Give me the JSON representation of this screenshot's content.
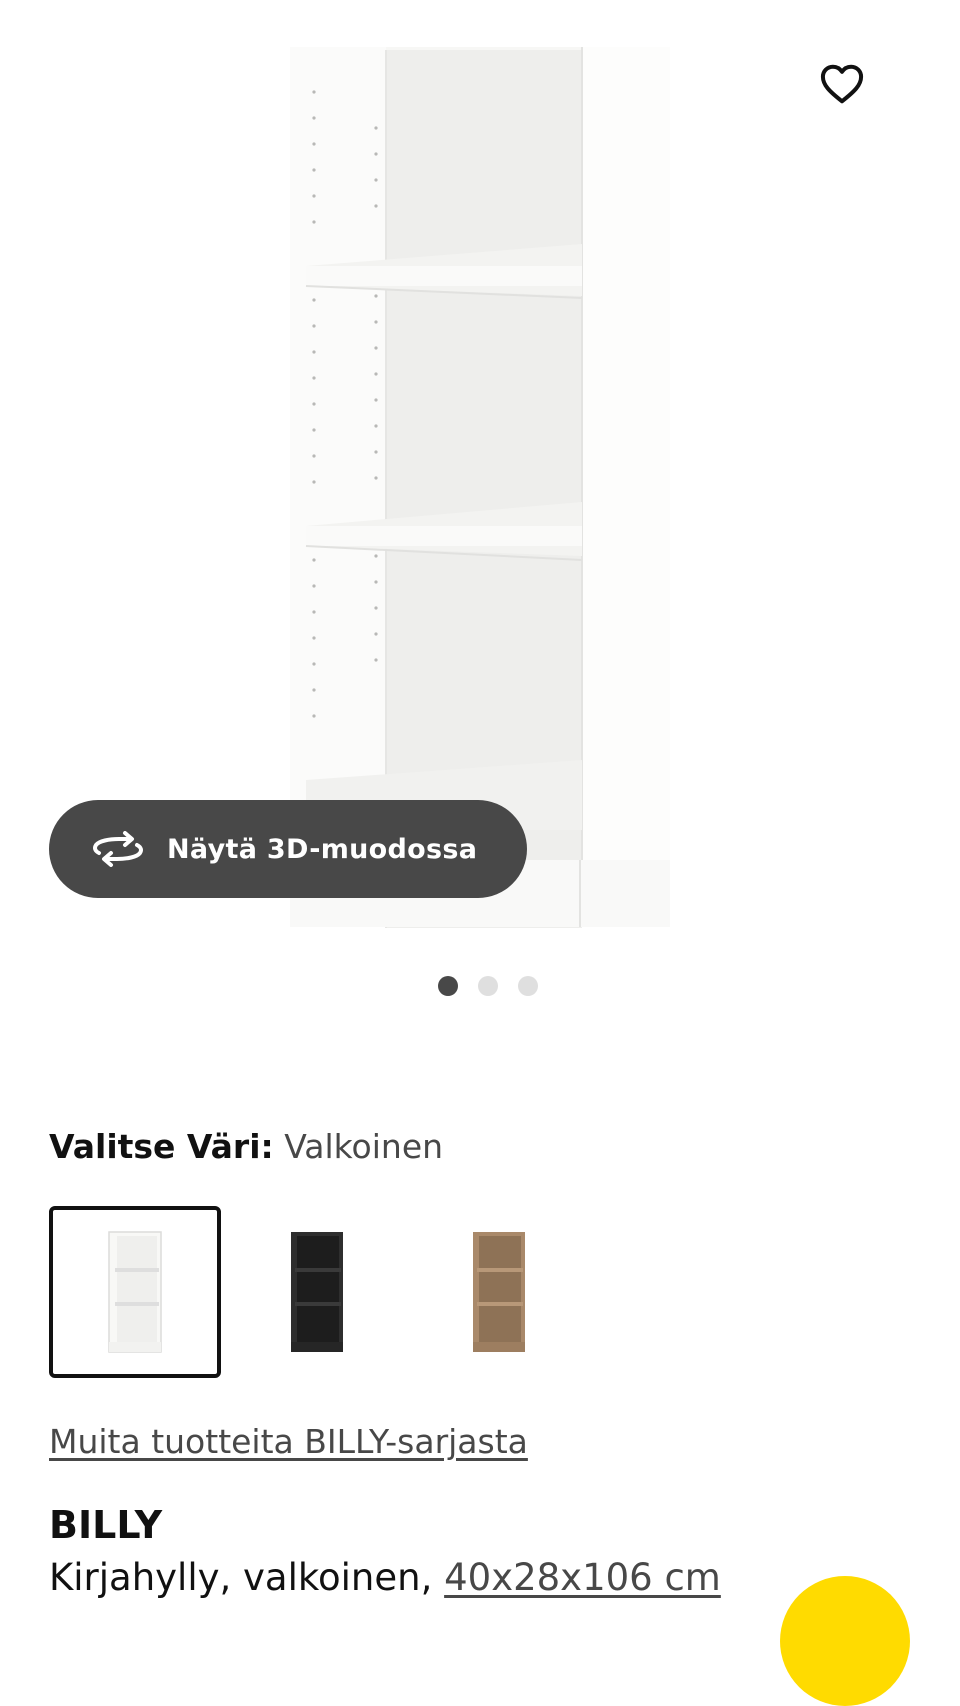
{
  "gallery": {
    "view_3d_label": "Näytä 3D-muodossa",
    "dots": [
      true,
      false,
      false
    ]
  },
  "color_select": {
    "heading": "Valitse Väri:",
    "selected_value": "Valkoinen",
    "swatches": [
      {
        "color": "#f6f6f4",
        "selected": true
      },
      {
        "color": "#2b2b2b",
        "selected": false
      },
      {
        "color": "#a98a68",
        "selected": false
      }
    ]
  },
  "series_link": "Muita tuotteita BILLY-sarjasta",
  "product": {
    "name": "BILLY",
    "description": "Kirjahylly, valkoinen, ",
    "dimensions": "40x28x106 cm"
  },
  "colors": {
    "accent_yellow": "#ffdb00",
    "dark_button": "#484848"
  }
}
